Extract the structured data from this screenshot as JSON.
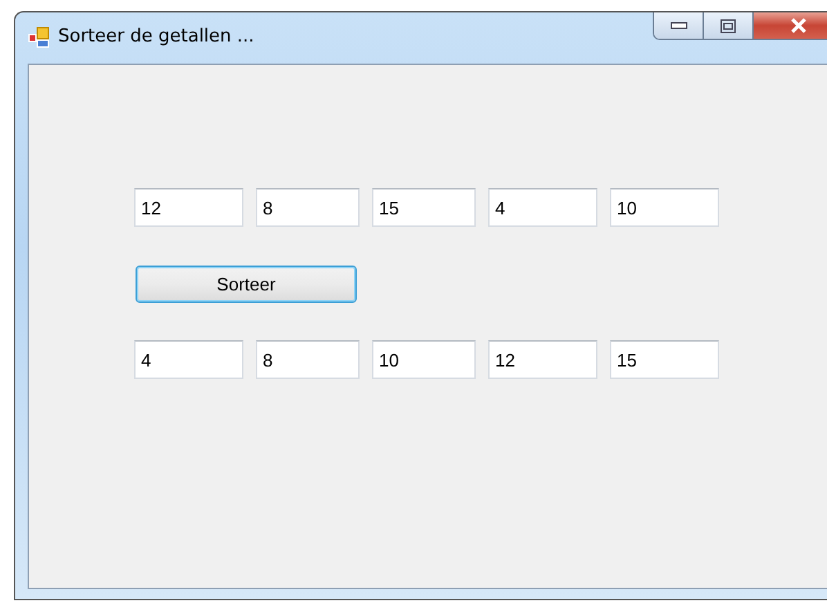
{
  "window": {
    "title": "Sorteer de getallen ..."
  },
  "input_fields": [
    {
      "value": "12"
    },
    {
      "value": "8"
    },
    {
      "value": "15"
    },
    {
      "value": "4"
    },
    {
      "value": "10"
    }
  ],
  "sort_button": {
    "label": "Sorteer",
    "focused": true
  },
  "output_fields": [
    {
      "value": "4"
    },
    {
      "value": "8"
    },
    {
      "value": "10"
    },
    {
      "value": "12"
    },
    {
      "value": "15"
    }
  ]
}
